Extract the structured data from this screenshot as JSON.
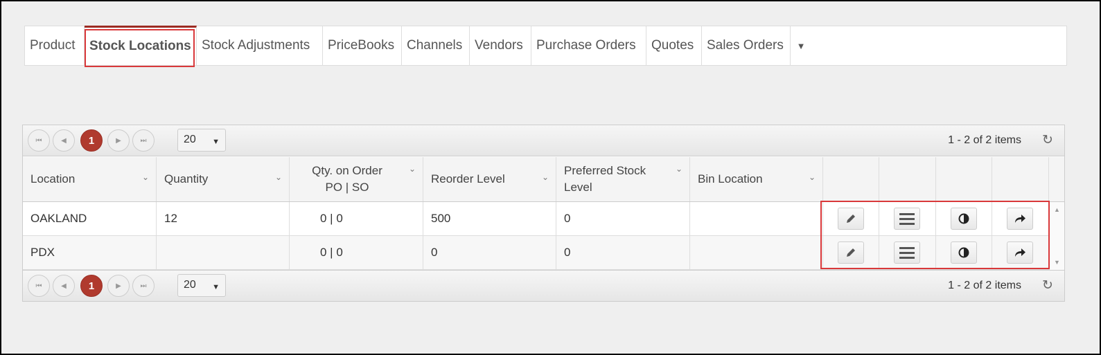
{
  "tabs": [
    {
      "label": "Product"
    },
    {
      "label": "Stock Locations",
      "active": true
    },
    {
      "label": "Stock Adjustments"
    },
    {
      "label": "PriceBooks"
    },
    {
      "label": "Channels"
    },
    {
      "label": "Vendors"
    },
    {
      "label": "Purchase Orders"
    },
    {
      "label": "Quotes"
    },
    {
      "label": "Sales Orders"
    }
  ],
  "tabs_more_icon": "caret-down-icon",
  "pager": {
    "current_page": "1",
    "page_size": "20",
    "info": "1 - 2 of 2 items"
  },
  "grid": {
    "columns": [
      "Location",
      "Quantity",
      "Qty. on Order PO | SO",
      "Reorder Level",
      "Preferred Stock Level",
      "Bin Location"
    ],
    "column_lines": {
      "qty_on_order": [
        "Qty. on Order",
        "PO | SO"
      ],
      "preferred": [
        "Preferred Stock",
        "Level"
      ]
    },
    "rows": [
      {
        "location": "OAKLAND",
        "quantity": "12",
        "on_order": "0 | 0",
        "reorder": "500",
        "preferred": "0",
        "bin": ""
      },
      {
        "location": "PDX",
        "quantity": "",
        "on_order": "0 | 0",
        "reorder": "0",
        "preferred": "0",
        "bin": ""
      }
    ],
    "row_actions": [
      "edit-icon",
      "list-icon",
      "contrast-icon",
      "share-arrow-icon"
    ]
  },
  "colors": {
    "accent": "#b03a2e",
    "highlight": "#d9383a"
  }
}
